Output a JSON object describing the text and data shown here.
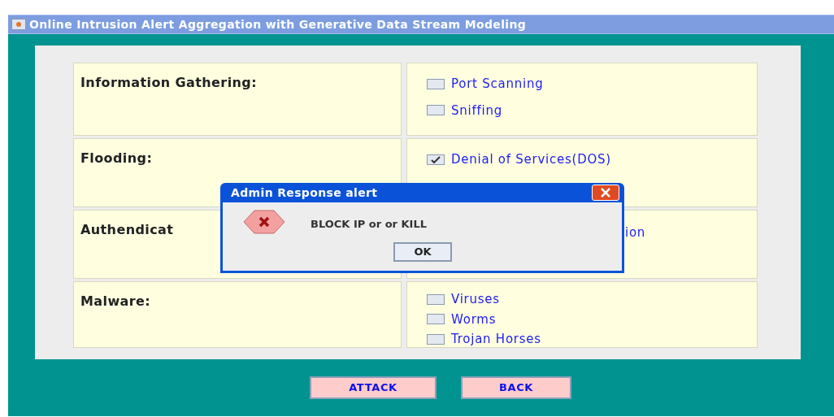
{
  "window": {
    "title": "Online Intrusion Alert Aggregation with Generative Data Stream Modeling"
  },
  "categories": [
    {
      "label": "Information Gathering:",
      "options": [
        {
          "kind": "checkbox",
          "label": "Port Scanning",
          "checked": false
        },
        {
          "kind": "checkbox",
          "label": "Sniffing",
          "checked": false
        }
      ]
    },
    {
      "label": "Flooding:",
      "options": [
        {
          "kind": "checkbox",
          "label": "Denial of Services(DOS)",
          "checked": true
        }
      ]
    },
    {
      "label": "Authendicat",
      "options": [
        {
          "kind": "text",
          "label": "ion"
        }
      ]
    },
    {
      "label": "Malware:",
      "options": [
        {
          "kind": "checkbox",
          "label": "Viruses",
          "checked": false
        },
        {
          "kind": "checkbox",
          "label": "Worms",
          "checked": false
        },
        {
          "kind": "checkbox",
          "label": "Trojan Horses",
          "checked": false
        }
      ]
    }
  ],
  "buttons": [
    "ATTACK",
    "BACK"
  ],
  "dialog": {
    "title": "Admin Response alert",
    "message": "BLOCK IP or or KILL",
    "button": "OK"
  }
}
